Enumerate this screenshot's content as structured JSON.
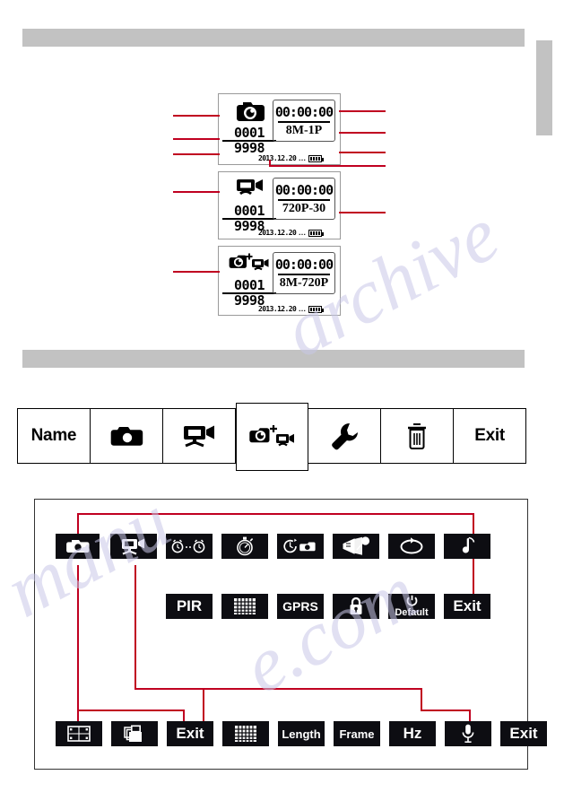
{
  "watermark": {
    "lines": [
      "manu",
      "archive",
      "e.com"
    ]
  },
  "colors": {
    "leader_red": "#c00020",
    "tile_black": "#0d0d12",
    "gray_bar": "#c2c2c2",
    "lcd_border": "#9a9a9a"
  },
  "lcd_panels": [
    {
      "id": "photo",
      "icon": "camera-icon",
      "count_top": "0001",
      "count_bottom": "9998",
      "time": "00:00:00",
      "mode": "8M-1P",
      "date": "2013.12.20",
      "dots": "...",
      "battery": "battery-full-icon"
    },
    {
      "id": "video",
      "icon": "video-camera-icon",
      "count_top": "0001",
      "count_bottom": "9998",
      "time": "00:00:00",
      "mode": "720P-30",
      "date": "2013.12.20",
      "dots": "...",
      "battery": "battery-full-icon"
    },
    {
      "id": "combo",
      "icon": "camera-plus-video-icon",
      "count_top": "0001",
      "count_bottom": "9998",
      "time": "00:00:00",
      "mode": "8M-720P",
      "date": "2013.12.20",
      "dots": "...",
      "battery": "battery-full-icon"
    }
  ],
  "menubar": {
    "cells": [
      {
        "type": "text",
        "label": "Name",
        "icon": null
      },
      {
        "type": "icon",
        "label": "",
        "icon": "camera-icon"
      },
      {
        "type": "icon",
        "label": "",
        "icon": "video-camera-icon"
      },
      {
        "type": "icon",
        "label": "",
        "icon": "camera-plus-video-icon"
      },
      {
        "type": "icon",
        "label": "",
        "icon": "wrench-icon"
      },
      {
        "type": "icon",
        "label": "",
        "icon": "trash-icon"
      },
      {
        "type": "text",
        "label": "Exit",
        "icon": null
      }
    ]
  },
  "settings_row1": [
    {
      "label": "",
      "icon": "camera-icon"
    },
    {
      "label": "",
      "icon": "video-camera-icon"
    },
    {
      "label": "",
      "icon": "alarm-clocks-icon"
    },
    {
      "label": "",
      "icon": "stopwatch-icon"
    },
    {
      "label": "",
      "icon": "timer-camera-icon"
    },
    {
      "label": "",
      "icon": "motion-sensor-icon"
    },
    {
      "label": "",
      "icon": "loop-arrow-icon"
    },
    {
      "label": "",
      "icon": "music-note-icon"
    }
  ],
  "settings_row2": [
    {
      "label": "PIR",
      "icon": null
    },
    {
      "label": "",
      "icon": "grid-keypad-icon"
    },
    {
      "label": "GPRS",
      "icon": null
    },
    {
      "label": "",
      "icon": "lock-icon"
    },
    {
      "label": "Default",
      "icon": "power-icon"
    },
    {
      "label": "Exit",
      "icon": null
    }
  ],
  "settings_row3": [
    {
      "label": "",
      "icon": "resolution-frame-icon"
    },
    {
      "label": "",
      "icon": "stacked-photos-icon"
    },
    {
      "label": "Exit",
      "icon": null
    },
    {
      "label": "",
      "icon": "grid-keypad-icon"
    },
    {
      "label": "Length",
      "icon": null
    },
    {
      "label": "Frame",
      "icon": null
    },
    {
      "label": "Hz",
      "icon": null
    },
    {
      "label": "",
      "icon": "microphone-icon"
    },
    {
      "label": "Exit",
      "icon": null
    }
  ]
}
